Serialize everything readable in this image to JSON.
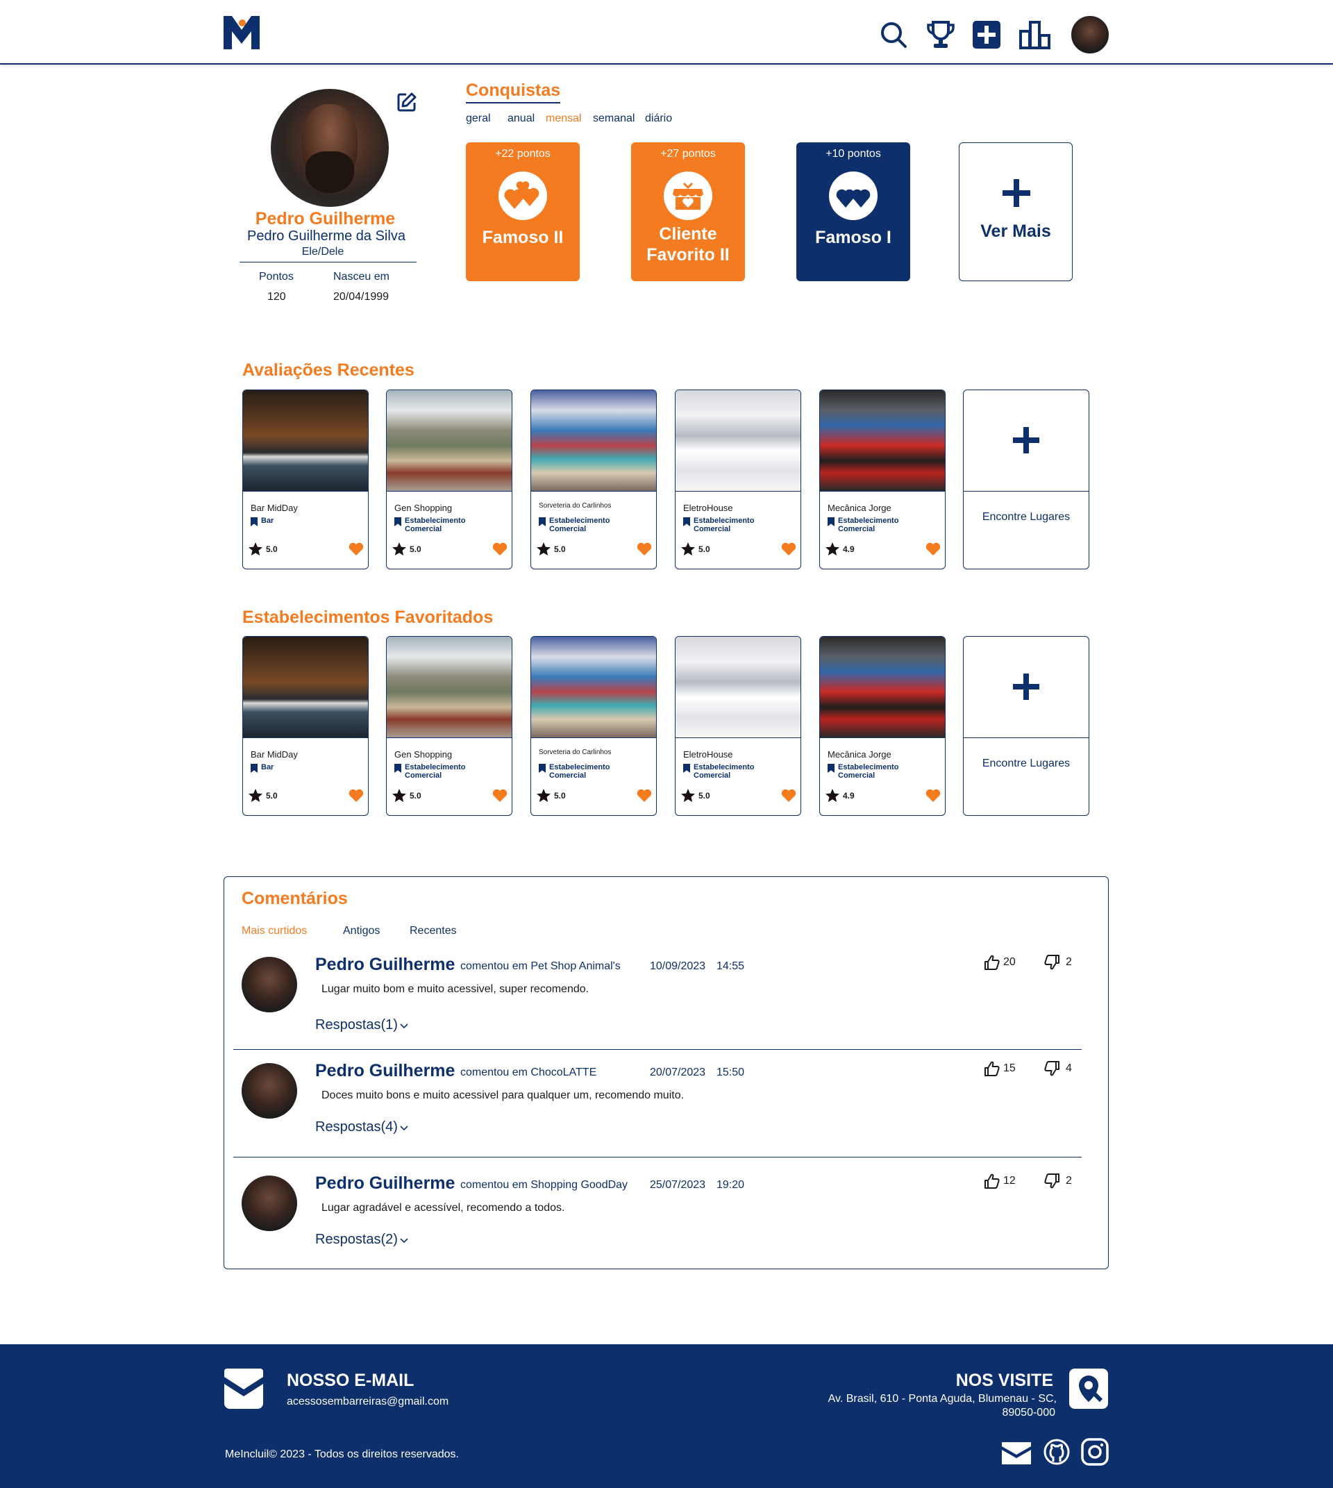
{
  "header": {
    "logo_icon": "menclui-logo-icon",
    "icons": [
      "search-icon",
      "trophy-icon",
      "add-icon",
      "ranking-icon"
    ],
    "avatar_icon": "avatar"
  },
  "profile": {
    "display_name": "Pedro Guilherme",
    "full_name": "Pedro Guilherme da Silva",
    "pronouns": "Ele/Dele",
    "points_label": "Pontos",
    "points_value": "120",
    "birth_label": "Nasceu em",
    "birth_value": "20/04/1999",
    "edit_icon": "edit-icon"
  },
  "achievements": {
    "title": "Conquistas",
    "filters": [
      "geral",
      "anual",
      "mensal",
      "semanal",
      "diário"
    ],
    "active_filter": "mensal",
    "items": [
      {
        "points": "+22 pontos",
        "name": "Famoso II",
        "color": "#f47b20",
        "icon": "hearts-icon"
      },
      {
        "points": "+27 pontos",
        "name": "Cliente Favorito II",
        "color": "#f47b20",
        "icon": "store-icon"
      },
      {
        "points": "+10 pontos",
        "name": "Famoso I",
        "color": "#0d2f6b",
        "icon": "hearts-icon"
      }
    ],
    "more_label": "Ver Mais"
  },
  "recent_reviews": {
    "title": "Avaliações Recentes",
    "cards": [
      {
        "name": "Bar MidDay",
        "category": "Bar",
        "rating": "5.0"
      },
      {
        "name": "Gen Shopping",
        "category": "Estabelecimento Comercial",
        "rating": "5.0"
      },
      {
        "name": "Sorveteria do Carlinhos",
        "category": "Estabelecimento Comercial",
        "rating": "5.0"
      },
      {
        "name": "EletroHouse",
        "category": "Estabelecimento Comercial",
        "rating": "5.0"
      },
      {
        "name": "Mecânica Jorge",
        "category": "Estabelecimento Comercial",
        "rating": "4.9"
      }
    ],
    "more_label": "Encontre Lugares"
  },
  "favorites": {
    "title": "Estabelecimentos Favoritados",
    "cards": [
      {
        "name": "Bar MidDay",
        "category": "Bar",
        "rating": "5.0"
      },
      {
        "name": "Gen Shopping",
        "category": "Estabelecimento Comercial",
        "rating": "5.0"
      },
      {
        "name": "Sorveteria do Carlinhos",
        "category": "Estabelecimento Comercial",
        "rating": "5.0"
      },
      {
        "name": "EletroHouse",
        "category": "Estabelecimento Comercial",
        "rating": "5.0"
      },
      {
        "name": "Mecânica Jorge",
        "category": "Estabelecimento Comercial",
        "rating": "4.9"
      }
    ],
    "more_label": "Encontre Lugares"
  },
  "comments": {
    "title": "Comentários",
    "tabs": [
      "Mais curtidos",
      "Antigos",
      "Recentes"
    ],
    "active_tab": "Mais curtidos",
    "items": [
      {
        "user": "Pedro Guilherme",
        "place": "comentou em Pet Shop Animal's",
        "date": "10/09/2023",
        "time": "14:55",
        "text": "Lugar muito bom e muito acessivel, super recomendo.",
        "likes": "20",
        "dislikes": "2",
        "replies": "Respostas(1)"
      },
      {
        "user": "Pedro Guilherme",
        "place": "comentou em ChocoLATTE",
        "date": "20/07/2023",
        "time": "15:50",
        "text": "Doces muito bons e muito acessivel para qualquer um, recomendo muito.",
        "likes": "15",
        "dislikes": "4",
        "replies": "Respostas(4)"
      },
      {
        "user": "Pedro Guilherme",
        "place": "comentou em Shopping GoodDay",
        "date": "25/07/2023",
        "time": "19:20",
        "text": "Lugar agradável e acessível, recomendo a todos.",
        "likes": "12",
        "dislikes": "2",
        "replies": "Respostas(2)"
      }
    ]
  },
  "footer": {
    "email_title": "NOSSO E-MAIL",
    "email_value": "acessosembarreiras@gmail.com",
    "visit_title": "NOS VISITE",
    "address_line1": "Av. Brasil, 610 - Ponta Aguda, Blumenau - SC,",
    "address_line2": "89050-000",
    "copyright": "MeIncluil© 2023 - Todos os direitos reservados.",
    "social_icons": [
      "mail-icon",
      "github-icon",
      "instagram-icon"
    ]
  },
  "colors": {
    "navy": "#0d2f6b",
    "orange": "#f47b20"
  }
}
